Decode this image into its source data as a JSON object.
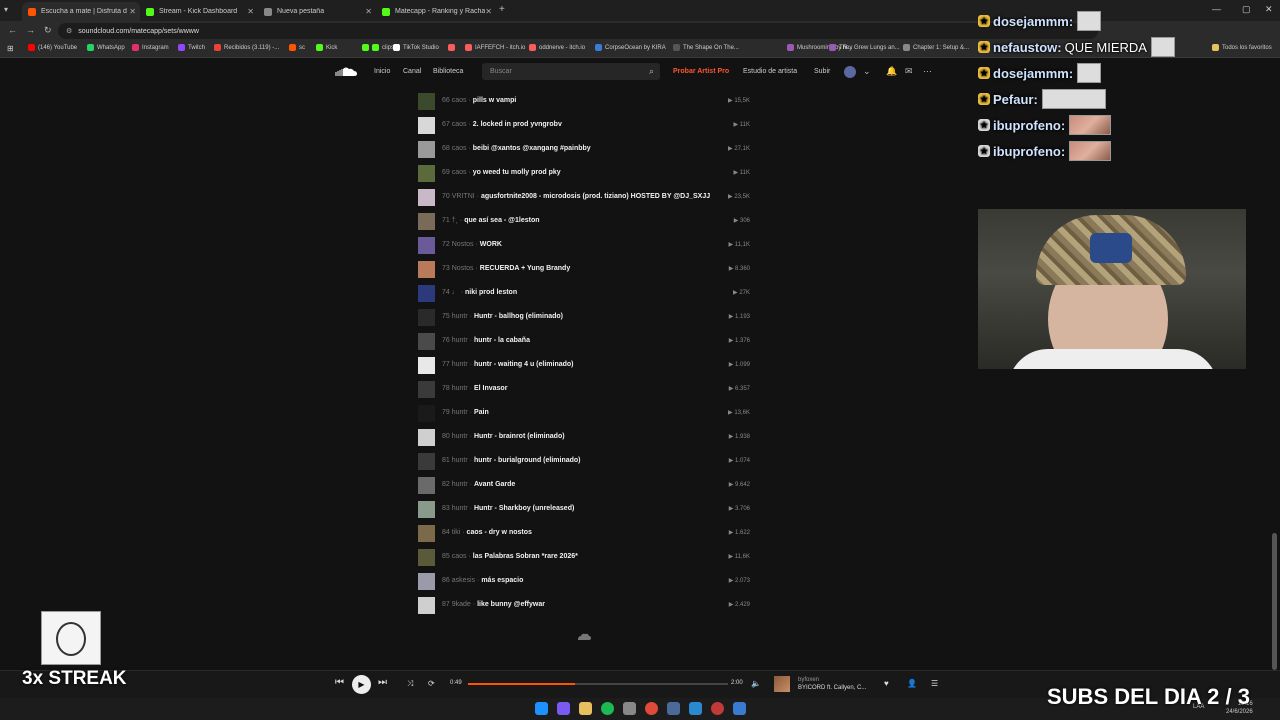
{
  "browser": {
    "tabs": [
      {
        "title": "Escucha a mate | Disfruta d",
        "active": true,
        "fav_color": "#ff5500"
      },
      {
        "title": "Stream - Kick Dashboard",
        "active": false,
        "fav_color": "#53fc18"
      },
      {
        "title": "Nueva pestaña",
        "active": false,
        "fav_color": "#888888"
      },
      {
        "title": "Matecapp - Ranking y Racha d",
        "active": false,
        "fav_color": "#53fc18"
      }
    ],
    "url": "soundcloud.com/matecapp/sets/wwww",
    "bookmarks": [
      {
        "label": "(146) YouTube",
        "color": "#ff0000"
      },
      {
        "label": "WhatsApp",
        "color": "#25d366"
      },
      {
        "label": "Instagram",
        "color": "#e1306c"
      },
      {
        "label": "Twitch",
        "color": "#9146ff"
      },
      {
        "label": "Recibidos (3.119) -...",
        "color": "#ea4335"
      },
      {
        "label": "sc",
        "color": "#ff5500"
      },
      {
        "label": "Kick",
        "color": "#53fc18"
      },
      {
        "label": "",
        "color": "#53fc18"
      },
      {
        "label": "clips",
        "color": "#53fc18"
      },
      {
        "label": "TikTok Studio",
        "color": "#ffffff"
      },
      {
        "label": "",
        "color": "#fa5c5c"
      },
      {
        "label": "IAFFEFCH - itch.io",
        "color": "#fa5c5c"
      },
      {
        "label": "oddnerve - itch.io",
        "color": "#fa5c5c"
      },
      {
        "label": "CorpseOcean by KIRA",
        "color": "#3a7bd5"
      },
      {
        "label": "The Shape On The...",
        "color": "#555555"
      },
      {
        "label": "Mushrooming by R...",
        "color": "#9b59b6"
      },
      {
        "label": "They Grew Lungs an...",
        "color": "#9b59b6"
      },
      {
        "label": "Chapter 1: Setup &...",
        "color": "#888888"
      }
    ],
    "bookmarks_right": "Todos los favoritos"
  },
  "soundcloud": {
    "nav": [
      "Inicio",
      "Canal",
      "Biblioteca"
    ],
    "search_placeholder": "Buscar",
    "pro_label": "Probar Artist Pro",
    "studio_label": "Estudio de artista",
    "upload_label": "Subir"
  },
  "tracks": [
    {
      "num": "66",
      "artist": "caos",
      "title": "pills w vampi",
      "plays": "15,5K",
      "art": "#3a4a2a"
    },
    {
      "num": "67",
      "artist": "caos",
      "title": "2. locked in prod yvngrobv",
      "plays": "11K",
      "art": "#d8d8d8"
    },
    {
      "num": "68",
      "artist": "caos",
      "title": "beibi @xantos @xangang #painbby",
      "plays": "27,1K",
      "art": "#9a9a9a"
    },
    {
      "num": "69",
      "artist": "caos",
      "title": "yo weed tu molly prod pky",
      "plays": "11K",
      "art": "#5a6a3a"
    },
    {
      "num": "70",
      "artist": "VRITNI",
      "title": "agusfortnite2008 - microdosis (prod. tiziano) HOSTED BY @DJ_SXJJ",
      "plays": "23,5K",
      "art": "#c8b8c8"
    },
    {
      "num": "71",
      "artist": "†¸",
      "title": "que así sea - @1leston",
      "plays": "306",
      "art": "#7a6a5a"
    },
    {
      "num": "72",
      "artist": "Nostos",
      "title": "WORK",
      "plays": "11,1K",
      "art": "#6a5a9a"
    },
    {
      "num": "73",
      "artist": "Nostos",
      "title": "RECUERDA + Yung Brandy",
      "plays": "8.360",
      "art": "#b87a5a"
    },
    {
      "num": "74",
      "artist": "♩",
      "title": "niki prod leston",
      "plays": "27K",
      "art": "#2a3a7a"
    },
    {
      "num": "75",
      "artist": "huntr",
      "title": "Huntr - ballhog (eliminado)",
      "plays": "1.193",
      "art": "#2a2a2a"
    },
    {
      "num": "76",
      "artist": "huntr",
      "title": "huntr - la cabaña",
      "plays": "1.376",
      "art": "#4a4a4a"
    },
    {
      "num": "77",
      "artist": "huntr",
      "title": "huntr - waiting 4 u (eliminado)",
      "plays": "1.099",
      "art": "#e8e8e8"
    },
    {
      "num": "78",
      "artist": "huntr",
      "title": "El Invasor",
      "plays": "6.357",
      "art": "#3a3a3a"
    },
    {
      "num": "79",
      "artist": "huntr",
      "title": "Pain",
      "plays": "13,6K",
      "art": "#1a1a1a"
    },
    {
      "num": "80",
      "artist": "huntr",
      "title": "Huntr - brainrot (eliminado)",
      "plays": "1.938",
      "art": "#cfcfcf"
    },
    {
      "num": "81",
      "artist": "huntr",
      "title": "huntr - burialground (eliminado)",
      "plays": "1.074",
      "art": "#3a3a3a"
    },
    {
      "num": "82",
      "artist": "huntr",
      "title": "Avant Garde",
      "plays": "9.642",
      "art": "#6a6a6a"
    },
    {
      "num": "83",
      "artist": "huntr",
      "title": "Huntr - Sharkboy (unreleased)",
      "plays": "3.706",
      "art": "#8a9a8a"
    },
    {
      "num": "84",
      "artist": "tiki",
      "title": "caos - dry w nostos",
      "plays": "1.622",
      "art": "#7a6a4a"
    },
    {
      "num": "85",
      "artist": "caos",
      "title": "las Palabras Sobran *rare 2026*",
      "plays": "11,6K",
      "art": "#5a5a3a"
    },
    {
      "num": "86",
      "artist": "askesis",
      "title": "más espacio",
      "plays": "2.073",
      "art": "#9a9aaa"
    },
    {
      "num": "87",
      "artist": "9kade",
      "title": "like bunny @effywar",
      "plays": "2.429",
      "art": "#cfcfcf"
    }
  ],
  "player": {
    "current_time": "0:49",
    "total_time": "2:00",
    "progress": 0.41,
    "artist": "byfoxen",
    "title": "BYICORD ft. Callyen, C..."
  },
  "chat": [
    {
      "user": "dosejammm:",
      "msg": "",
      "badge_color": "#f0c040",
      "emote": "plain"
    },
    {
      "user": "nefaustow:",
      "msg": "QUE MIERDA",
      "badge_color": "#f0c040",
      "emote": "plain"
    },
    {
      "user": "dosejammm:",
      "msg": "",
      "badge_color": "#f0c040",
      "emote": "plain"
    },
    {
      "user": "Pefaur:",
      "msg": "",
      "badge_color": "#f0c040",
      "emote": "wide"
    },
    {
      "user": "ibuprofeno:",
      "msg": "",
      "badge_color": "#dddddd",
      "emote": "img"
    },
    {
      "user": "ibuprofeno:",
      "msg": "",
      "badge_color": "#dddddd",
      "emote": "img"
    }
  ],
  "overlay": {
    "streak": "3x STREAK",
    "subs": "SUBS DEL DIA 2 / 3"
  },
  "taskbar": {
    "lang": "LAA",
    "time": "19:16",
    "date": "24/6/2026"
  }
}
